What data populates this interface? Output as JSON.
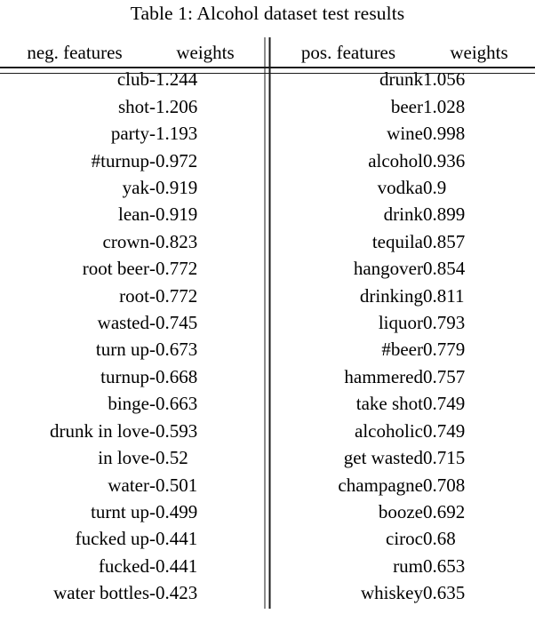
{
  "caption": {
    "text": "Table 1: Alcohol dataset test results",
    "label": "Table 1",
    "title": "Alcohol dataset test results"
  },
  "table": {
    "headers": {
      "neg_features": "neg. features",
      "neg_weights": "weights",
      "separator": "||",
      "pos_features": "pos. features",
      "pos_weights": "weights"
    },
    "colors": {
      "rule": "#1a1a1a",
      "text": "#000000",
      "background": "#ffffff"
    },
    "row_count": 20,
    "rows": [
      {
        "neg_feature": "club",
        "neg_weight": "-1.244",
        "pos_feature": "drunk",
        "pos_weight": "1.056"
      },
      {
        "neg_feature": "shot",
        "neg_weight": "-1.206",
        "pos_feature": "beer",
        "pos_weight": "1.028"
      },
      {
        "neg_feature": "party",
        "neg_weight": "-1.193",
        "pos_feature": "wine",
        "pos_weight": "0.998"
      },
      {
        "neg_feature": "#turnup",
        "neg_weight": "-0.972",
        "pos_feature": "alcohol",
        "pos_weight": "0.936"
      },
      {
        "neg_feature": "yak",
        "neg_weight": "-0.919",
        "pos_feature": "vodka",
        "pos_weight": "0.9"
      },
      {
        "neg_feature": "lean",
        "neg_weight": "-0.919",
        "pos_feature": "drink",
        "pos_weight": "0.899"
      },
      {
        "neg_feature": "crown",
        "neg_weight": "-0.823",
        "pos_feature": "tequila",
        "pos_weight": "0.857"
      },
      {
        "neg_feature": "root beer",
        "neg_weight": "-0.772",
        "pos_feature": "hangover",
        "pos_weight": "0.854"
      },
      {
        "neg_feature": "root",
        "neg_weight": "-0.772",
        "pos_feature": "drinking",
        "pos_weight": "0.811"
      },
      {
        "neg_feature": "wasted",
        "neg_weight": "-0.745",
        "pos_feature": "liquor",
        "pos_weight": "0.793"
      },
      {
        "neg_feature": "turn up",
        "neg_weight": "-0.673",
        "pos_feature": "#beer",
        "pos_weight": "0.779"
      },
      {
        "neg_feature": "turnup",
        "neg_weight": "-0.668",
        "pos_feature": "hammered",
        "pos_weight": "0.757"
      },
      {
        "neg_feature": "binge",
        "neg_weight": "-0.663",
        "pos_feature": "take shot",
        "pos_weight": "0.749"
      },
      {
        "neg_feature": "drunk in love",
        "neg_weight": "-0.593",
        "pos_feature": "alcoholic",
        "pos_weight": "0.749"
      },
      {
        "neg_feature": "in love",
        "neg_weight": "-0.52",
        "pos_feature": "get wasted",
        "pos_weight": "0.715"
      },
      {
        "neg_feature": "water",
        "neg_weight": "-0.501",
        "pos_feature": "champagne",
        "pos_weight": "0.708"
      },
      {
        "neg_feature": "turnt up",
        "neg_weight": "-0.499",
        "pos_feature": "booze",
        "pos_weight": "0.692"
      },
      {
        "neg_feature": "fucked up",
        "neg_weight": "-0.441",
        "pos_feature": "ciroc",
        "pos_weight": "0.68"
      },
      {
        "neg_feature": "fucked",
        "neg_weight": "-0.441",
        "pos_feature": "rum",
        "pos_weight": "0.653"
      },
      {
        "neg_feature": "water bottles",
        "neg_weight": "-0.423",
        "pos_feature": "whiskey",
        "pos_weight": "0.635"
      }
    ]
  }
}
